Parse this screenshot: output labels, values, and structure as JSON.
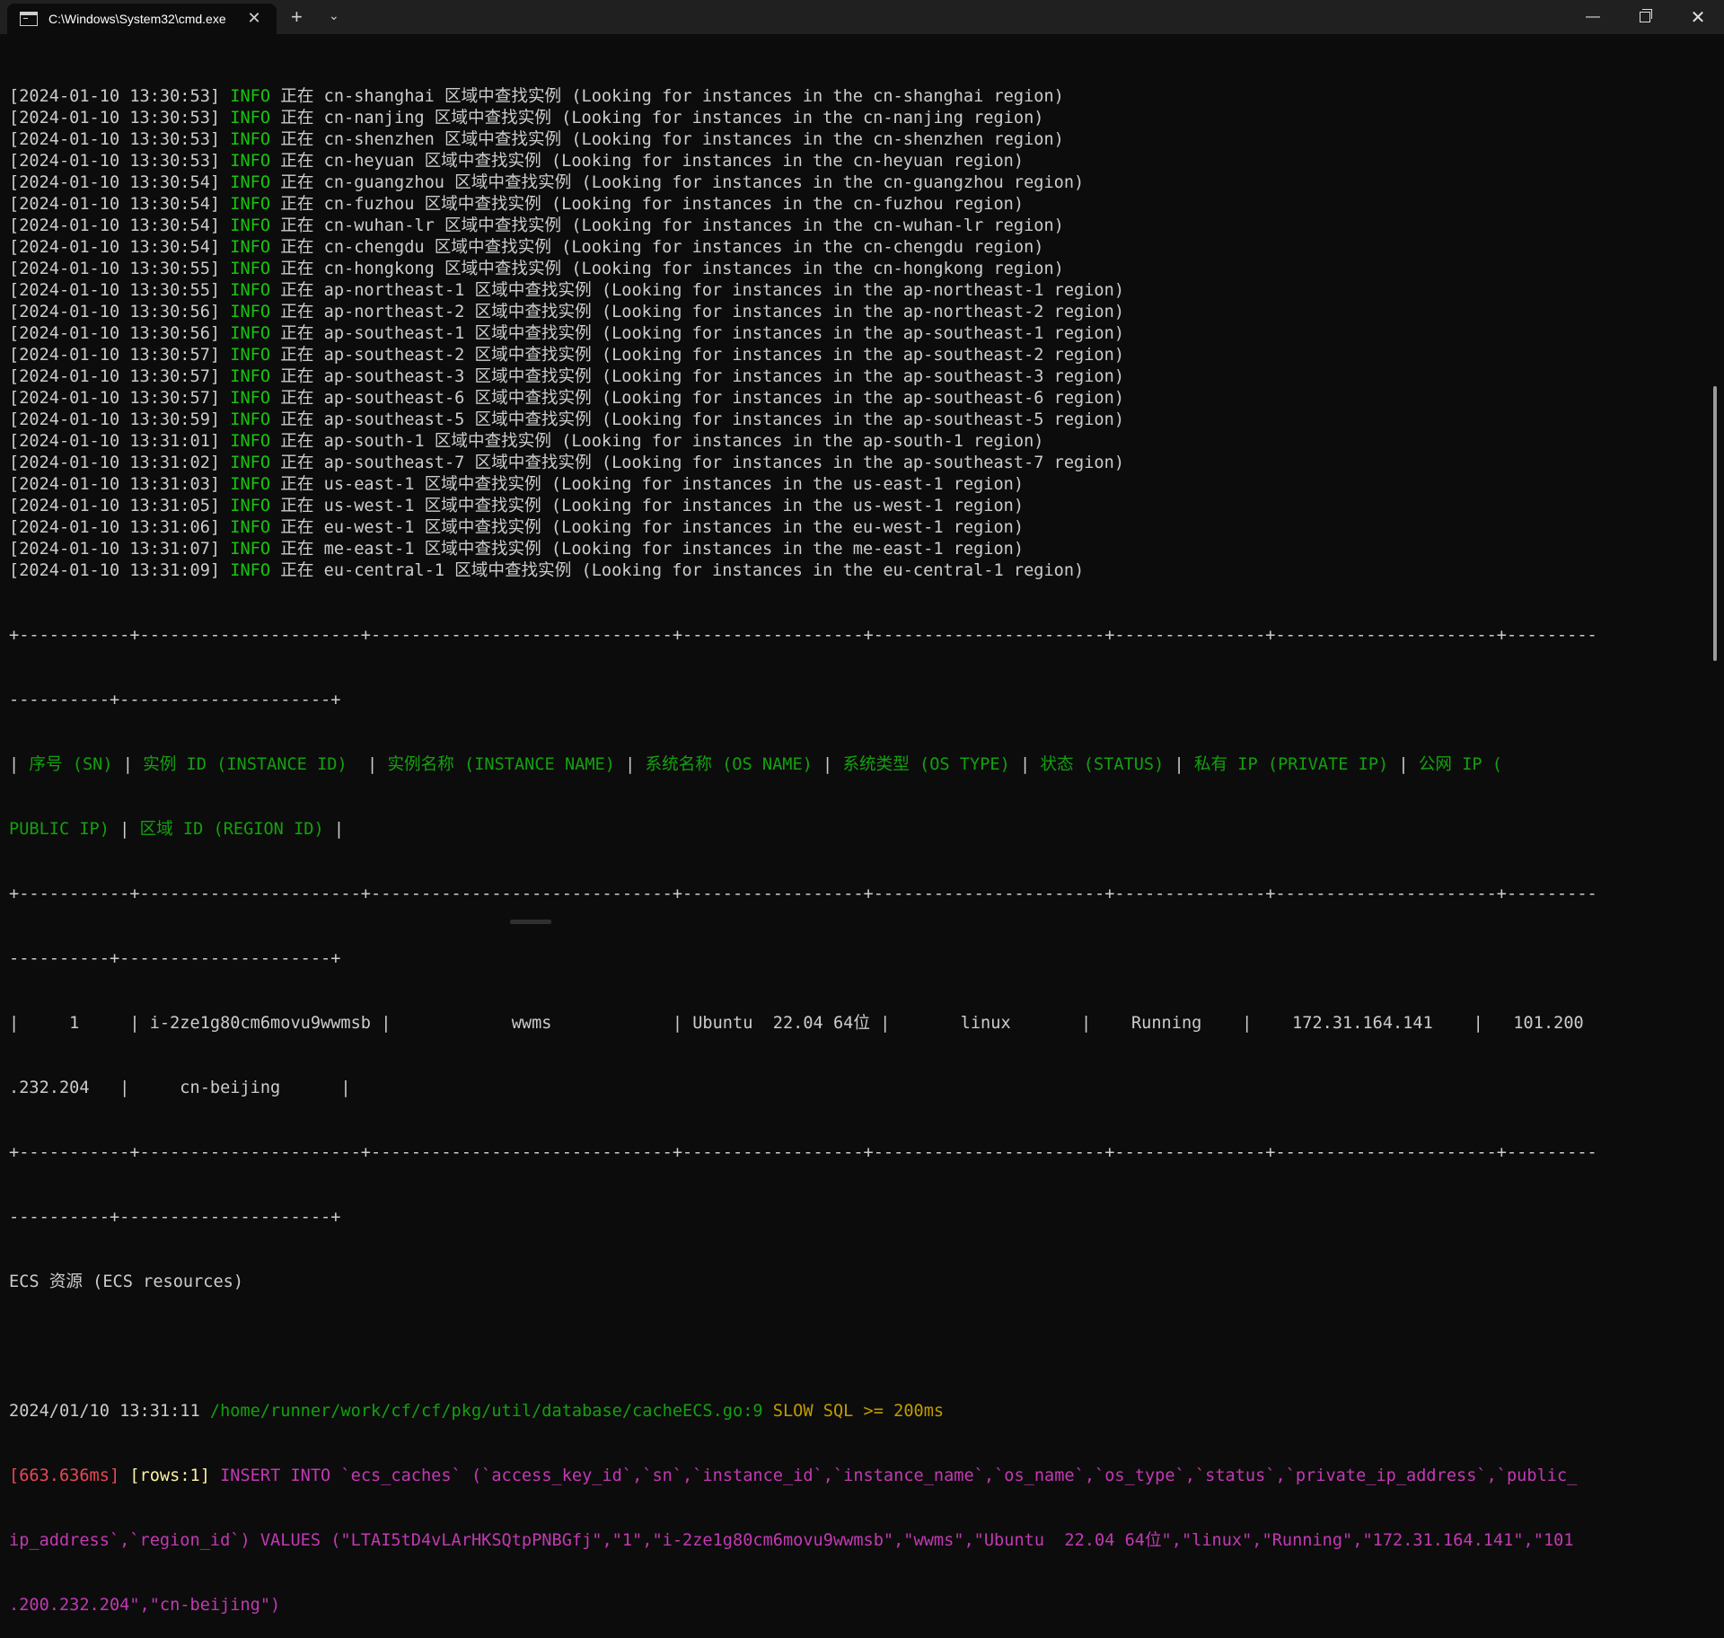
{
  "window": {
    "tab_title": "C:\\Windows\\System32\\cmd.exe",
    "tab_close": "✕",
    "new_tab": "+",
    "dropdown": "⌄",
    "minimize": "—",
    "close": "✕"
  },
  "colors": {
    "background": "#0c0c0c",
    "text": "#cccccc",
    "info": "#16c60c",
    "header_green": "#13a10e",
    "slow_yellow": "#c19c00",
    "sql_red": "#e74856",
    "rows_yellow": "#f9f1a5",
    "sql_magenta": "#c239b3"
  },
  "log_lines": [
    {
      "ts": "[2024-01-10 13:30:53] ",
      "level": "INFO",
      "msg": " 正在 cn-shanghai 区域中查找实例 (Looking for instances in the cn-shanghai region)"
    },
    {
      "ts": "[2024-01-10 13:30:53] ",
      "level": "INFO",
      "msg": " 正在 cn-nanjing 区域中查找实例 (Looking for instances in the cn-nanjing region)"
    },
    {
      "ts": "[2024-01-10 13:30:53] ",
      "level": "INFO",
      "msg": " 正在 cn-shenzhen 区域中查找实例 (Looking for instances in the cn-shenzhen region)"
    },
    {
      "ts": "[2024-01-10 13:30:53] ",
      "level": "INFO",
      "msg": " 正在 cn-heyuan 区域中查找实例 (Looking for instances in the cn-heyuan region)"
    },
    {
      "ts": "[2024-01-10 13:30:54] ",
      "level": "INFO",
      "msg": " 正在 cn-guangzhou 区域中查找实例 (Looking for instances in the cn-guangzhou region)"
    },
    {
      "ts": "[2024-01-10 13:30:54] ",
      "level": "INFO",
      "msg": " 正在 cn-fuzhou 区域中查找实例 (Looking for instances in the cn-fuzhou region)"
    },
    {
      "ts": "[2024-01-10 13:30:54] ",
      "level": "INFO",
      "msg": " 正在 cn-wuhan-lr 区域中查找实例 (Looking for instances in the cn-wuhan-lr region)"
    },
    {
      "ts": "[2024-01-10 13:30:54] ",
      "level": "INFO",
      "msg": " 正在 cn-chengdu 区域中查找实例 (Looking for instances in the cn-chengdu region)"
    },
    {
      "ts": "[2024-01-10 13:30:55] ",
      "level": "INFO",
      "msg": " 正在 cn-hongkong 区域中查找实例 (Looking for instances in the cn-hongkong region)"
    },
    {
      "ts": "[2024-01-10 13:30:55] ",
      "level": "INFO",
      "msg": " 正在 ap-northeast-1 区域中查找实例 (Looking for instances in the ap-northeast-1 region)"
    },
    {
      "ts": "[2024-01-10 13:30:56] ",
      "level": "INFO",
      "msg": " 正在 ap-northeast-2 区域中查找实例 (Looking for instances in the ap-northeast-2 region)"
    },
    {
      "ts": "[2024-01-10 13:30:56] ",
      "level": "INFO",
      "msg": " 正在 ap-southeast-1 区域中查找实例 (Looking for instances in the ap-southeast-1 region)"
    },
    {
      "ts": "[2024-01-10 13:30:57] ",
      "level": "INFO",
      "msg": " 正在 ap-southeast-2 区域中查找实例 (Looking for instances in the ap-southeast-2 region)"
    },
    {
      "ts": "[2024-01-10 13:30:57] ",
      "level": "INFO",
      "msg": " 正在 ap-southeast-3 区域中查找实例 (Looking for instances in the ap-southeast-3 region)"
    },
    {
      "ts": "[2024-01-10 13:30:57] ",
      "level": "INFO",
      "msg": " 正在 ap-southeast-6 区域中查找实例 (Looking for instances in the ap-southeast-6 region)"
    },
    {
      "ts": "[2024-01-10 13:30:59] ",
      "level": "INFO",
      "msg": " 正在 ap-southeast-5 区域中查找实例 (Looking for instances in the ap-southeast-5 region)"
    },
    {
      "ts": "[2024-01-10 13:31:01] ",
      "level": "INFO",
      "msg": " 正在 ap-south-1 区域中查找实例 (Looking for instances in the ap-south-1 region)"
    },
    {
      "ts": "[2024-01-10 13:31:02] ",
      "level": "INFO",
      "msg": " 正在 ap-southeast-7 区域中查找实例 (Looking for instances in the ap-southeast-7 region)"
    },
    {
      "ts": "[2024-01-10 13:31:03] ",
      "level": "INFO",
      "msg": " 正在 us-east-1 区域中查找实例 (Looking for instances in the us-east-1 region)"
    },
    {
      "ts": "[2024-01-10 13:31:05] ",
      "level": "INFO",
      "msg": " 正在 us-west-1 区域中查找实例 (Looking for instances in the us-west-1 region)"
    },
    {
      "ts": "[2024-01-10 13:31:06] ",
      "level": "INFO",
      "msg": " 正在 eu-west-1 区域中查找实例 (Looking for instances in the eu-west-1 region)"
    },
    {
      "ts": "[2024-01-10 13:31:07] ",
      "level": "INFO",
      "msg": " 正在 me-east-1 区域中查找实例 (Looking for instances in the me-east-1 region)"
    },
    {
      "ts": "[2024-01-10 13:31:09] ",
      "level": "INFO",
      "msg": " 正在 eu-central-1 区域中查找实例 (Looking for instances in the eu-central-1 region)"
    }
  ],
  "table": {
    "border_a": "+-----------+----------------------+------------------------------+------------------+-----------------------+---------------+----------------------+---------",
    "border_b": "----------+---------------------+",
    "header_l1": [
      {
        "t": "| ",
        "c": "p"
      },
      {
        "t": "序号 (SN)",
        "c": "g"
      },
      {
        "t": " | ",
        "c": "p"
      },
      {
        "t": "实例 ID (INSTANCE ID)",
        "c": "g"
      },
      {
        "t": "  | ",
        "c": "p"
      },
      {
        "t": "实例名称 (INSTANCE NAME)",
        "c": "g"
      },
      {
        "t": " | ",
        "c": "p"
      },
      {
        "t": "系统名称 (OS NAME)",
        "c": "g"
      },
      {
        "t": " | ",
        "c": "p"
      },
      {
        "t": "系统类型 (OS TYPE)",
        "c": "g"
      },
      {
        "t": " | ",
        "c": "p"
      },
      {
        "t": "状态 (STATUS)",
        "c": "g"
      },
      {
        "t": " | ",
        "c": "p"
      },
      {
        "t": "私有 IP (PRIVATE IP)",
        "c": "g"
      },
      {
        "t": " | ",
        "c": "p"
      },
      {
        "t": "公网 IP (",
        "c": "g"
      }
    ],
    "header_l2": [
      {
        "t": "PUBLIC IP)",
        "c": "g"
      },
      {
        "t": " | ",
        "c": "p"
      },
      {
        "t": "区域 ID (REGION ID)",
        "c": "g"
      },
      {
        "t": " |",
        "c": "p"
      }
    ],
    "row_l1": "|     1     | i-2ze1g80cm6movu9wwmsb |            wwms            | Ubuntu  22.04 64位 |       linux       |    Running    |    172.31.164.141    |   101.200",
    "row_l2": ".232.204   |     cn-beijing      |"
  },
  "ecs_label": "ECS 资源 (ECS resources)",
  "sql": {
    "timestamp": "2024/01/10 13:31:11 ",
    "path": "/home/runner/work/cf/cf/pkg/util/database/cacheECS.go:9",
    "slow": " SLOW SQL >= 200ms",
    "duration": "[663.636ms] ",
    "rows": "[rows:1]",
    "stmt_l1": " INSERT INTO `ecs_caches` (`access_key_id`,`sn`,`instance_id`,`instance_name`,`os_name`,`os_type`,`status`,`private_ip_address`,`public_",
    "stmt_l2": "ip_address`,`region_id`) VALUES (\"LTAI5tD4vLArHKSQtpPNBGfj\",\"1\",\"i-2ze1g80cm6movu9wwmsb\",\"wwms\",\"Ubuntu  22.04 64位\",\"linux\",\"Running\",\"172.31.164.141\",\"101",
    "stmt_l3": ".200.232.204\",\"cn-beijing\")"
  }
}
